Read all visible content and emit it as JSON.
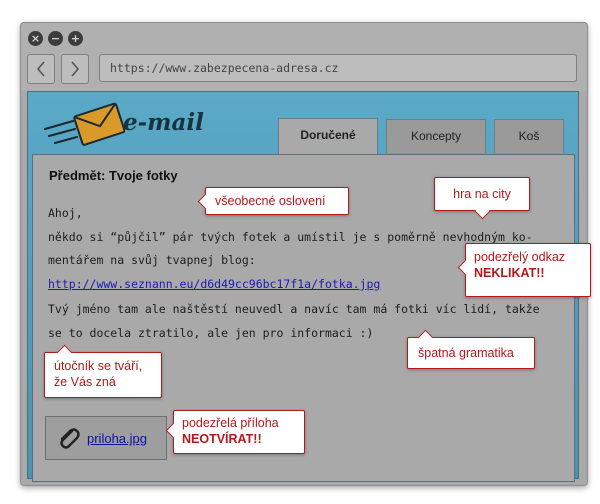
{
  "browser": {
    "url": "https://www.zabezpecena-adresa.cz",
    "window_buttons": [
      "close-icon",
      "minimize-icon",
      "maximize-icon"
    ],
    "nav": {
      "back_icon": "chevron-left-icon",
      "forward_icon": "chevron-right-icon"
    }
  },
  "app": {
    "logo_text": "e-mail",
    "logo_icon": "envelope-icon",
    "tabs": [
      {
        "label": "Doručené",
        "active": true
      },
      {
        "label": "Koncepty",
        "active": false
      },
      {
        "label": "Koš",
        "active": false
      }
    ]
  },
  "email": {
    "subject": "Předmět: Tvoje fotky",
    "greeting": "Ahoj,",
    "body_line1": "někdo si “půjčil” pár tvých fotek a umístil je s poměrně nevhodným ko-",
    "body_line2": "mentářem na svůj tvapnej blog:",
    "link": "http://www.seznann.eu/d6d49cc96bc17f1a/fotka.jpg",
    "body_line3": "Tvý jméno tam ale naštěstí neuvedl a navíc tam má fotki víc lidí, takže",
    "body_line4": "se to docela ztratilo, ale jen pro informaci :)",
    "attachment": {
      "label": "priloha.jpg",
      "icon": "paperclip-icon"
    }
  },
  "callouts": {
    "generic_greeting": "všeobecné oslovení",
    "emotions": "hra na city",
    "suspicious_link_1": "podezřelý odkaz",
    "suspicious_link_2": "NEKLIKAT!!",
    "bad_grammar": "špatná gramatika",
    "attacker_1": "útočník se tváří,",
    "attacker_2": "že Vás zná",
    "suspicious_attachment_1": "podezřelá příloha",
    "suspicious_attachment_2": "NEOTVÍRAT!!"
  },
  "colors": {
    "accent_red": "#b01a1a",
    "header_blue": "#5aa9c7",
    "link_blue": "#1a1ab8"
  }
}
